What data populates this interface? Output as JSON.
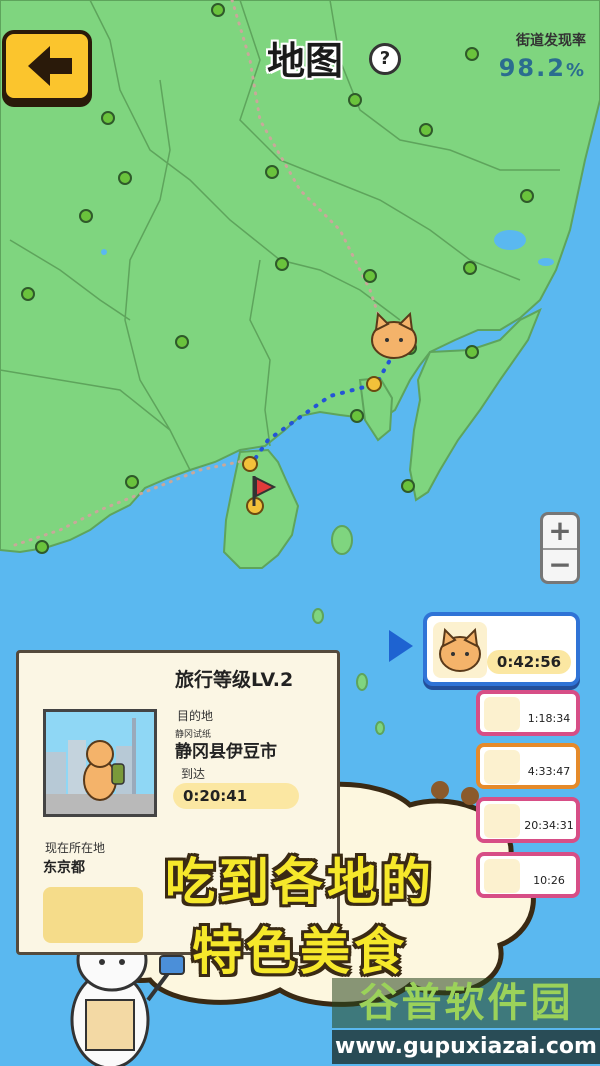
{
  "header": {
    "title": "地图",
    "help_label": "?",
    "discovery_label": "街道发现率",
    "discovery_value": "98.2",
    "discovery_unit": "%"
  },
  "zoom": {
    "in_label": "+",
    "out_label": "−"
  },
  "travel_card": {
    "level": "旅行等级LV.2",
    "destination_label": "目的地",
    "destination_sub": "静冈试纸",
    "destination_name": "静冈县伊豆市",
    "arrival_label": "到达",
    "arrival_time": "0:20:41",
    "current_label": "现在所在地",
    "current_name": "东京都"
  },
  "travelers": {
    "selected_time": "0:42:56",
    "list": [
      {
        "time": "1:18:34",
        "color": "#d74e86"
      },
      {
        "time": "4:33:47",
        "color": "#e58a2a"
      },
      {
        "time": "20:34:31",
        "color": "#d74e86"
      },
      {
        "time": "10:26",
        "color": "#d74e86"
      }
    ]
  },
  "promo": {
    "line1": "吃到各地的",
    "line2": "特色美食"
  },
  "watermark": {
    "name": "谷普软件园",
    "url": "www.gupuxiazai.com"
  },
  "colors": {
    "land": "#7fd57f",
    "sea": "#5ab8f0",
    "accent": "#fbc52d",
    "route": "#2454d6"
  }
}
